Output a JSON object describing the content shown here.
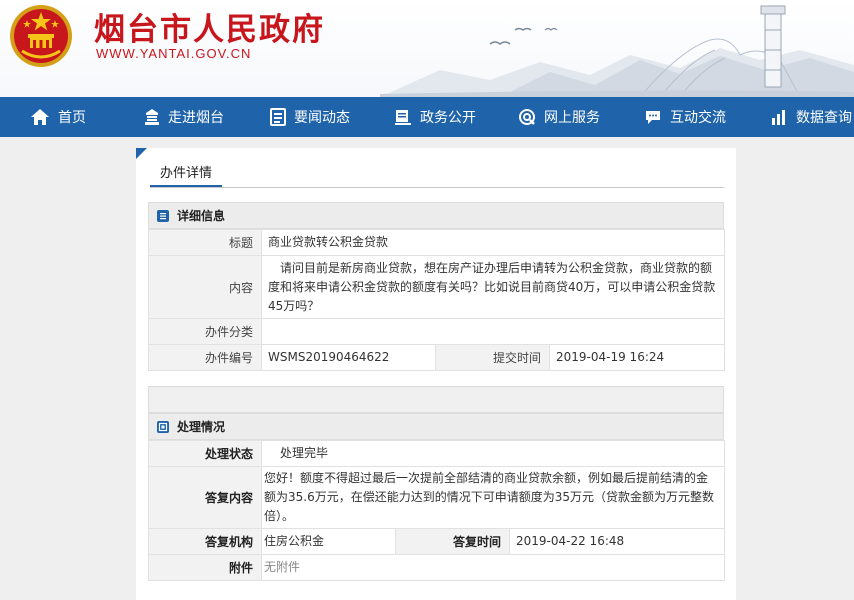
{
  "header": {
    "site_title": "烟台市人民政府",
    "site_url": "WWW.YANTAI.GOV.CN",
    "brand_color": "#c8161d"
  },
  "nav": {
    "bg_color": "#1f63aa",
    "items": [
      {
        "label": "首页",
        "icon": "home-icon"
      },
      {
        "label": "走进烟台",
        "icon": "city-icon"
      },
      {
        "label": "要闻动态",
        "icon": "news-icon"
      },
      {
        "label": "政务公开",
        "icon": "document-icon"
      },
      {
        "label": "网上服务",
        "icon": "service-icon"
      },
      {
        "label": "互动交流",
        "icon": "chat-icon"
      },
      {
        "label": "数据查询",
        "icon": "chart-icon"
      }
    ]
  },
  "tab": {
    "label": "办件详情"
  },
  "detail": {
    "heading": "详细信息",
    "title_label": "标题",
    "title_value": "商业贷款转公积金贷款",
    "content_label": "内容",
    "content_value": "请问目前是新房商业贷款，想在房产证办理后申请转为公积金贷款，商业贷款的额度和将来申请公积金贷款的额度有关吗？比如说目前商贷40万，可以申请公积金贷款45万吗？",
    "category_label": "办件分类",
    "category_value": "",
    "number_label": "办件编号",
    "number_value": "WSMS20190464622",
    "submit_label": "提交时间",
    "submit_value": "2019-04-19 16:24"
  },
  "handling": {
    "heading": "处理情况",
    "status_label": "处理状态",
    "status_value": "处理完毕",
    "reply_label": "答复内容",
    "reply_value": "您好！额度不得超过最后一次提前全部结清的商业贷款余额，例如最后提前结清的金额为35.6万元，在偿还能力达到的情况下可申请额度为35万元（贷款金额为万元整数倍）。",
    "org_label": "答复机构",
    "org_value": "住房公积金",
    "time_label": "答复时间",
    "time_value": "2019-04-22 16:48",
    "attach_label": "附件",
    "attach_value": "无附件"
  }
}
